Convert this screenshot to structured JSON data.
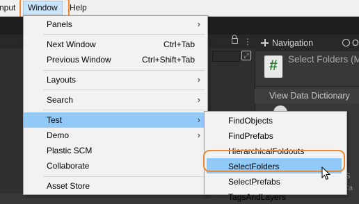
{
  "menubar": {
    "items": [
      {
        "label": "nput"
      },
      {
        "label": "Window"
      },
      {
        "label": "Help"
      }
    ]
  },
  "window_menu": {
    "items": [
      {
        "label": "Panels",
        "shortcut": "",
        "submenu": true
      },
      {
        "label": "Next Window",
        "shortcut": "Ctrl+Tab",
        "submenu": false
      },
      {
        "label": "Previous Window",
        "shortcut": "Ctrl+Shift+Tab",
        "submenu": false
      },
      {
        "label": "Layouts",
        "shortcut": "",
        "submenu": true
      },
      {
        "label": "Search",
        "shortcut": "",
        "submenu": true
      },
      {
        "label": "Test",
        "shortcut": "",
        "submenu": true,
        "highlighted": true
      },
      {
        "label": "Demo",
        "shortcut": "",
        "submenu": true
      },
      {
        "label": "Plastic SCM",
        "shortcut": "",
        "submenu": false
      },
      {
        "label": "Collaborate",
        "shortcut": "",
        "submenu": false
      },
      {
        "label": "Asset Store",
        "shortcut": "",
        "submenu": false
      }
    ]
  },
  "test_submenu": {
    "items": [
      {
        "label": "FindObjects"
      },
      {
        "label": "FindPrefabs"
      },
      {
        "label": "HierarchicalFoldouts"
      },
      {
        "label": "SelectFolders",
        "highlighted": true
      },
      {
        "label": "SelectPrefabs"
      },
      {
        "label": "TagsAndLayers"
      }
    ]
  },
  "inspector": {
    "tab_navigation": "Navigation",
    "tab_occlusion": "Occ",
    "script_icon_glyph": "#",
    "script_title": "Select Folders (M",
    "view_data_label": "View Data Dictionary",
    "faint_text_1": "nces",
    "faint_text_2": "s",
    "faint_text_3": "Ca"
  },
  "icons": {
    "lock": "lock-icon",
    "kebab": "kebab-menu-icon",
    "expand": "expand-icon",
    "chevron": "chevron-right-icon",
    "cursor": "mouse-cursor-icon"
  },
  "colors": {
    "menu_highlight": "#91c9f7",
    "menubar_active": "#cce4f7",
    "annotation_ring": "#ef8a33",
    "editor_dark": "#383838"
  }
}
